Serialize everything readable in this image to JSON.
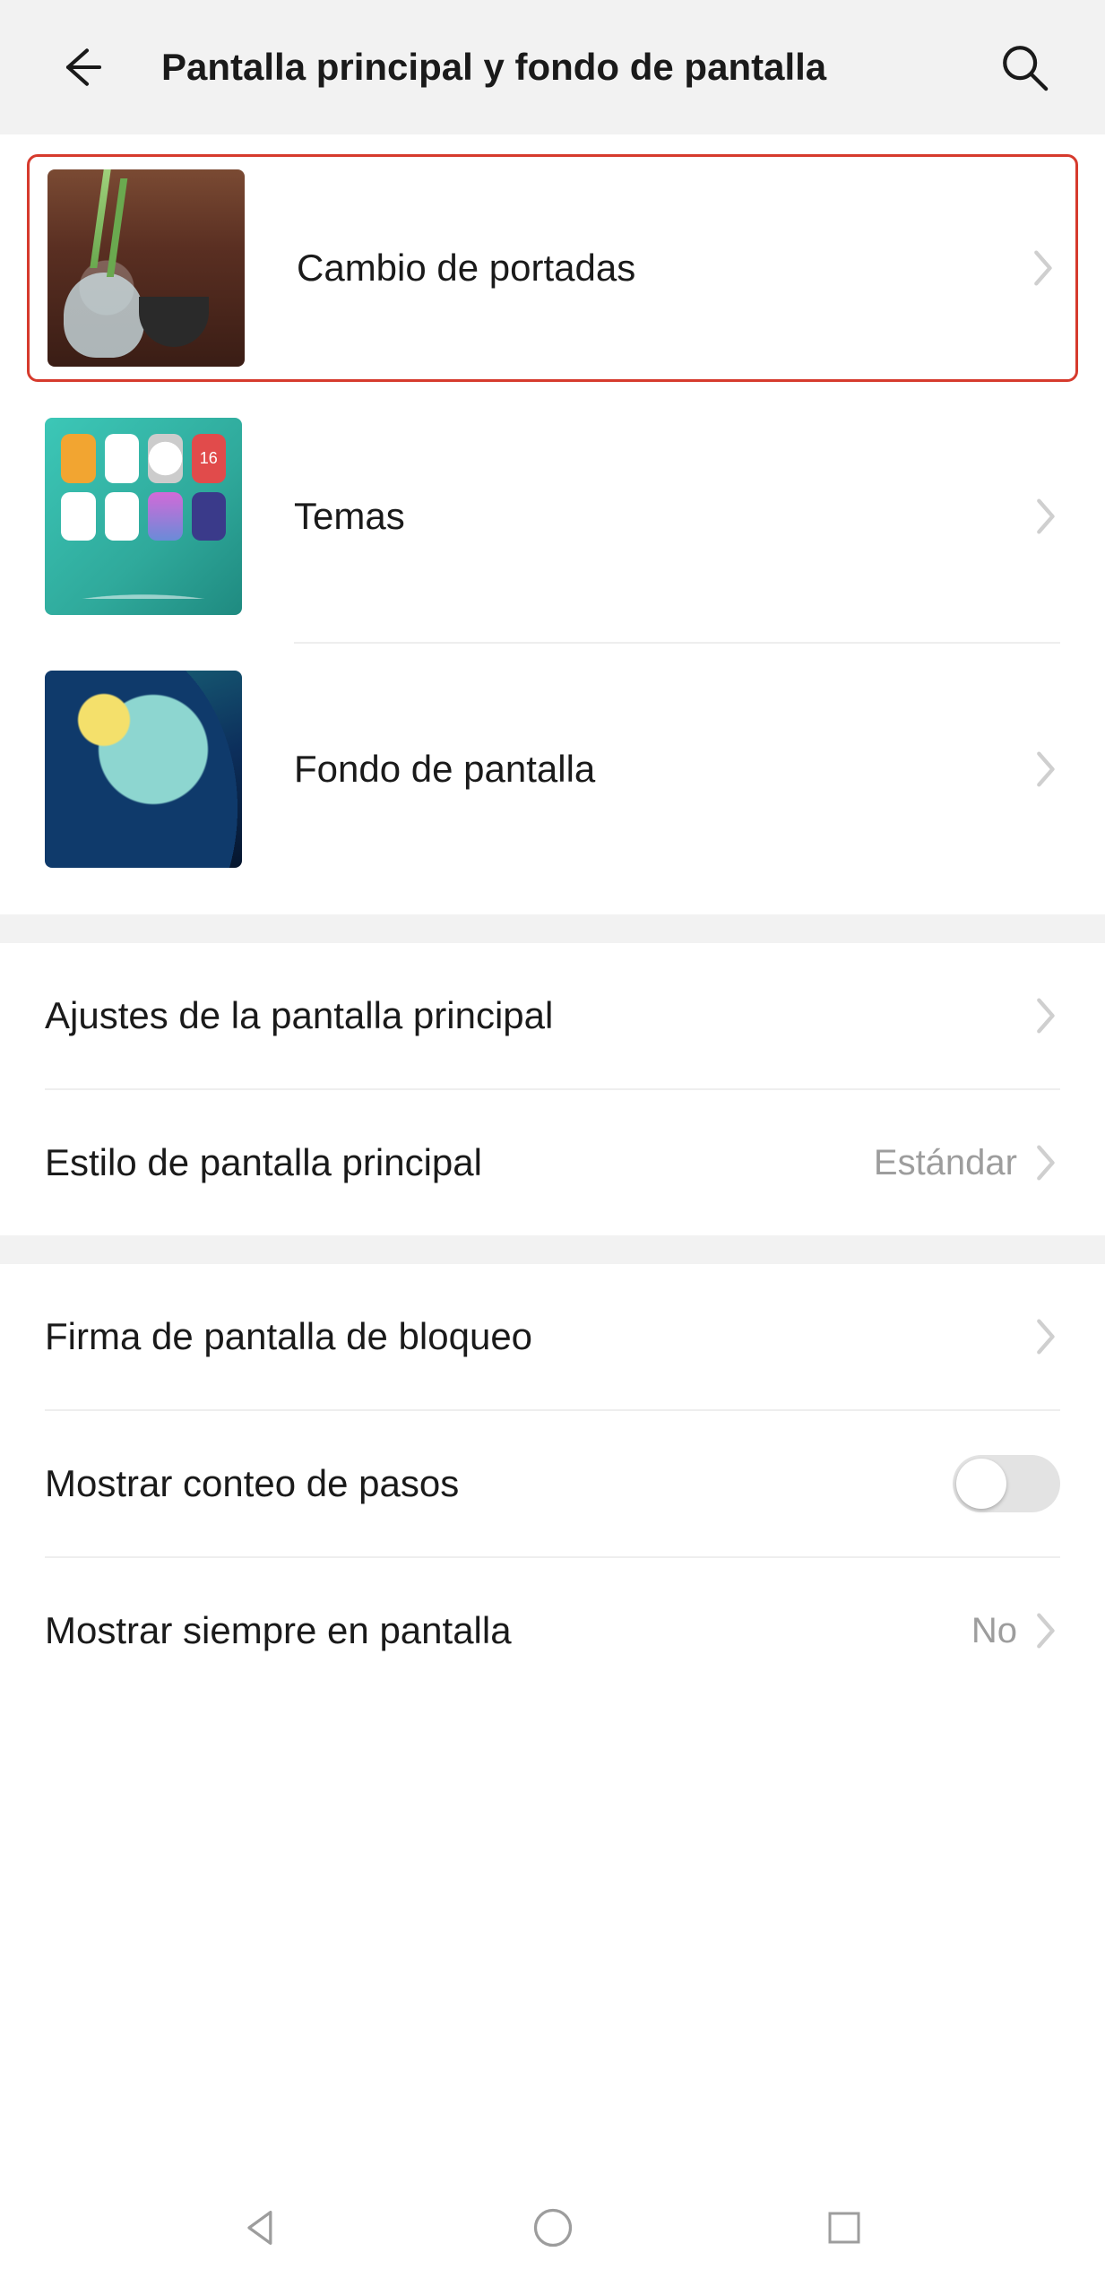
{
  "header": {
    "title": "Pantalla principal y fondo de pantalla"
  },
  "thumb_section": {
    "items": [
      {
        "label": "Cambio de portadas",
        "highlighted": true
      },
      {
        "label": "Temas"
      },
      {
        "label": "Fondo de pantalla"
      }
    ]
  },
  "section_home": {
    "items": [
      {
        "label": "Ajustes de la pantalla principal",
        "value": "",
        "type": "chevron"
      },
      {
        "label": "Estilo de pantalla principal",
        "value": "Estándar",
        "type": "chevron"
      }
    ]
  },
  "section_lock": {
    "items": [
      {
        "label": "Firma de pantalla de bloqueo",
        "value": "",
        "type": "chevron"
      },
      {
        "label": "Mostrar conteo de pasos",
        "value": "",
        "type": "switch",
        "on": false
      },
      {
        "label": "Mostrar siempre en pantalla",
        "value": "No",
        "type": "chevron"
      }
    ]
  }
}
